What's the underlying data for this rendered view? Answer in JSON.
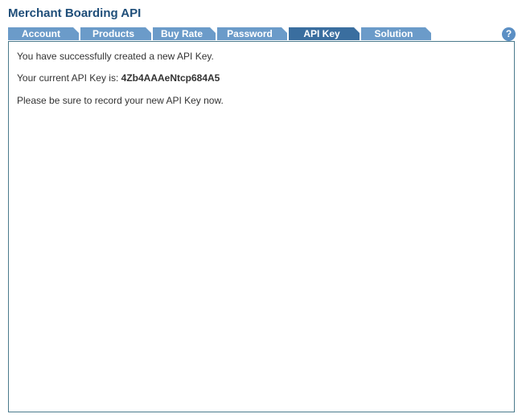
{
  "header": {
    "title": "Merchant Boarding API"
  },
  "tabs": [
    {
      "label": "Account",
      "active": false
    },
    {
      "label": "Products",
      "active": false
    },
    {
      "label": "Buy Rate",
      "active": false
    },
    {
      "label": "Password",
      "active": false
    },
    {
      "label": "API Key",
      "active": true
    },
    {
      "label": "Solution",
      "active": false
    }
  ],
  "help": {
    "symbol": "?"
  },
  "content": {
    "success_message": "You have successfully created a new API Key.",
    "key_label": "Your current API Key is:",
    "key_value": "4Zb4AAAeNtcp684A5",
    "reminder": "Please be sure to record your new API Key now."
  },
  "colors": {
    "title": "#1f4e79",
    "tab": "#6b9bc9",
    "tab_active": "#3a6e9f",
    "panel_border": "#4b7a8c",
    "help_icon": "#5b8fc4"
  }
}
